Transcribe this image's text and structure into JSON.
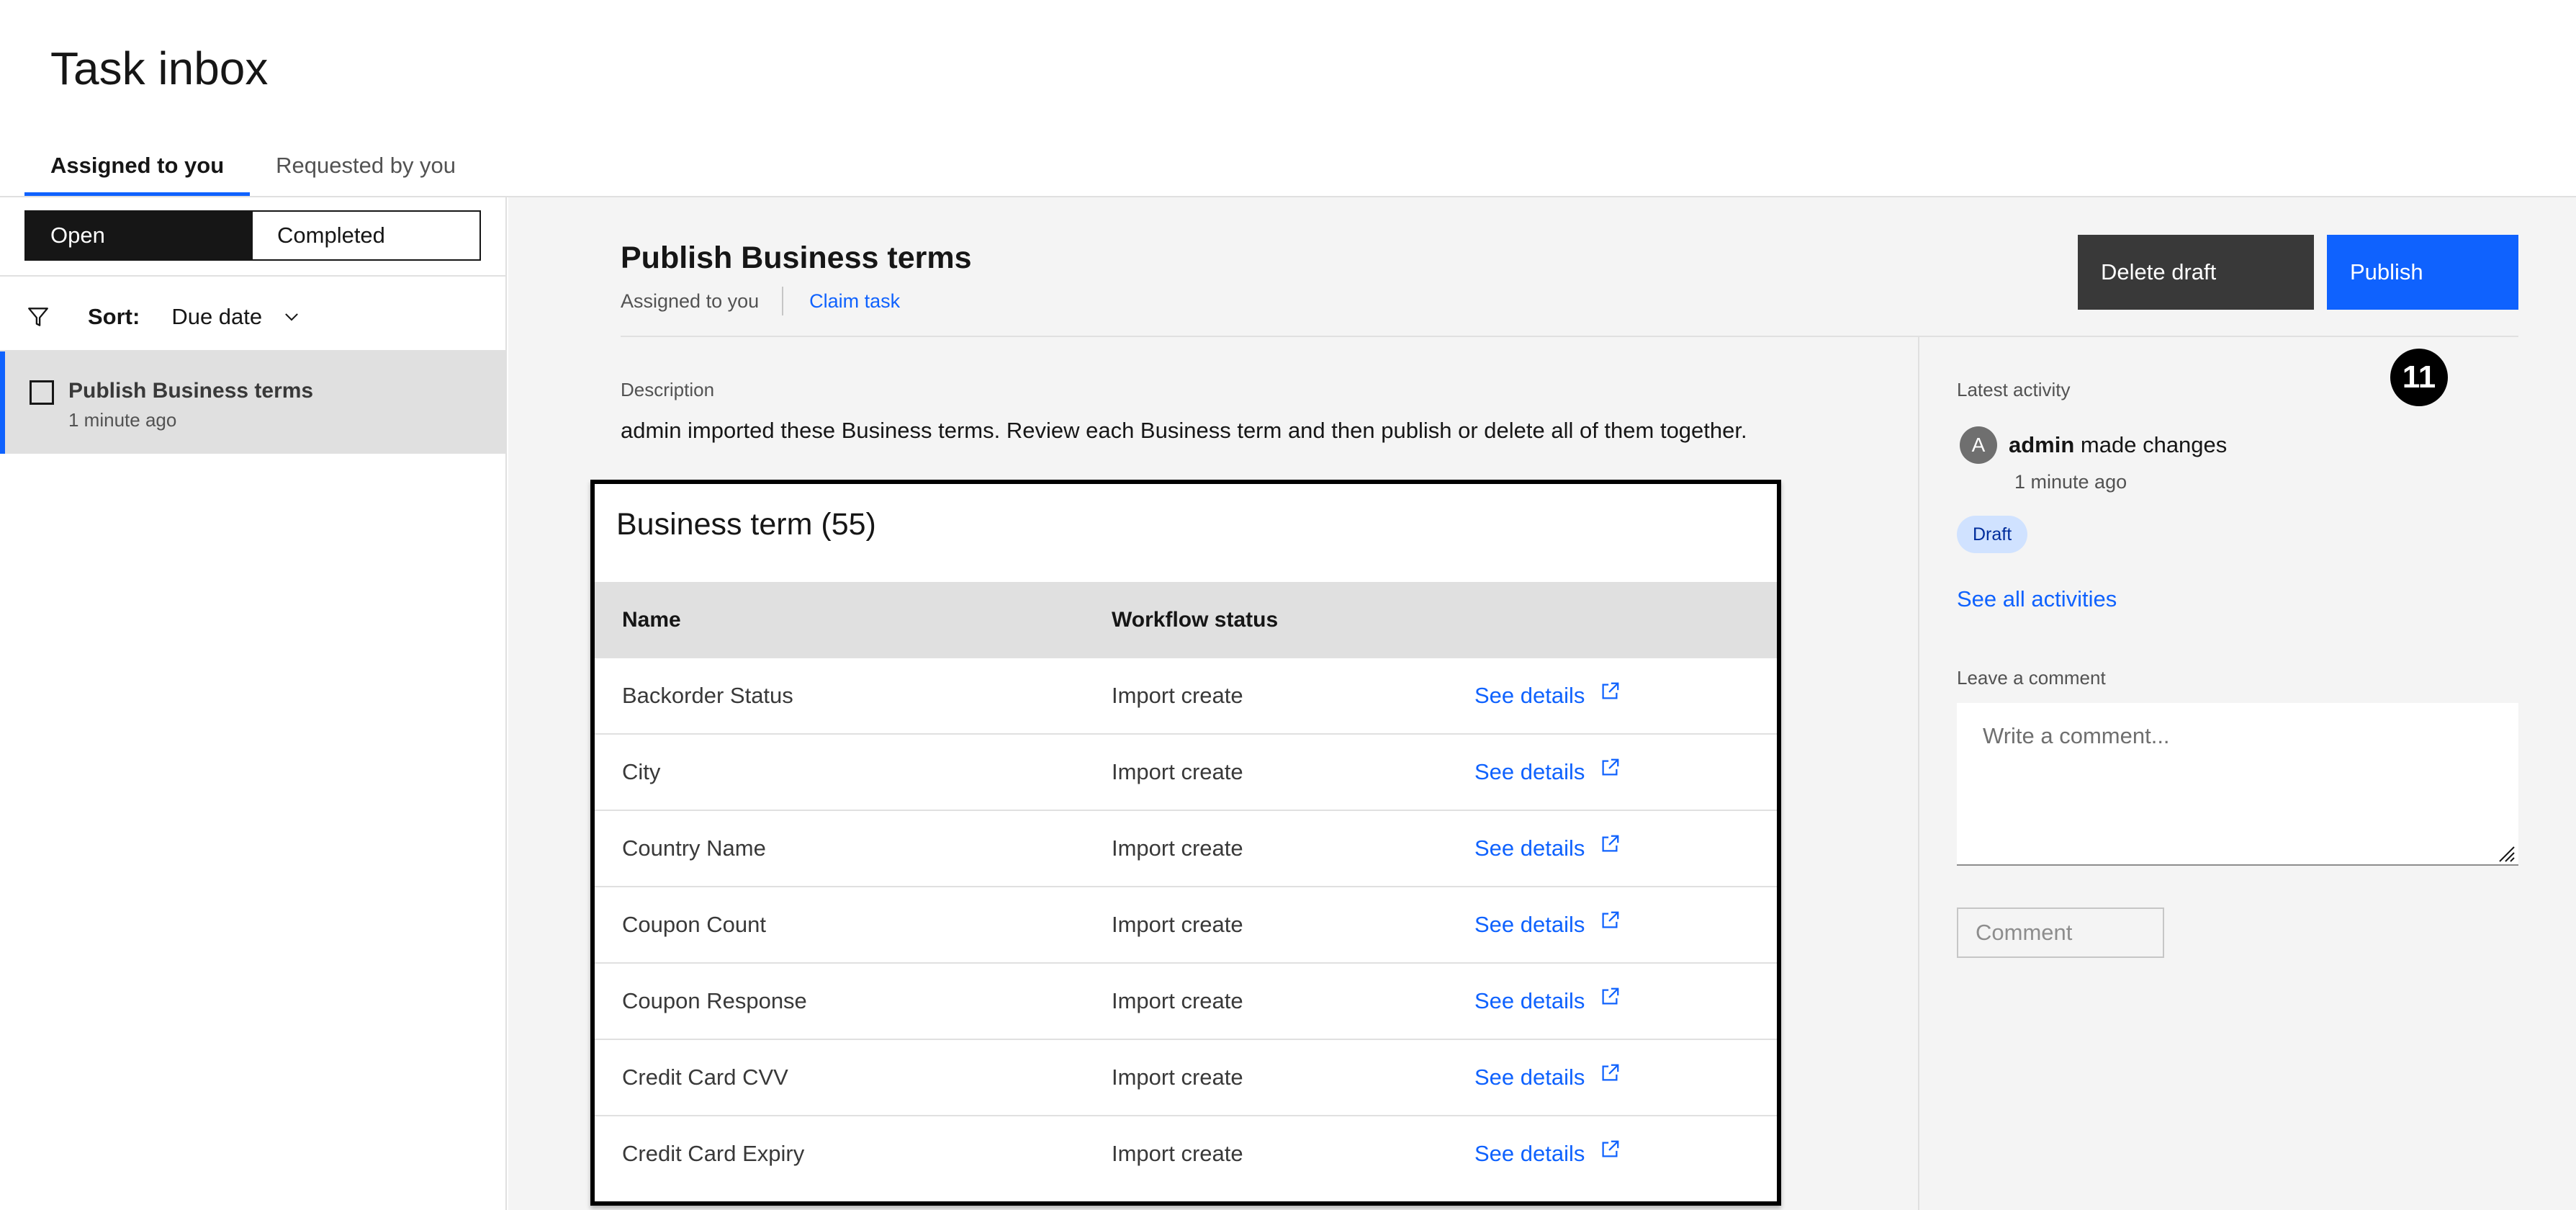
{
  "page": {
    "title": "Task inbox"
  },
  "tabs": [
    {
      "label": "Assigned to you",
      "active": true
    },
    {
      "label": "Requested by you",
      "active": false
    }
  ],
  "sidebar": {
    "segments": [
      {
        "label": "Open",
        "active": true
      },
      {
        "label": "Completed",
        "active": false
      }
    ],
    "filter_icon": "filter-icon",
    "sort_label": "Sort:",
    "sort_value": "Due date",
    "tasks": [
      {
        "title": "Publish Business terms",
        "time": "1 minute ago",
        "selected": true
      }
    ]
  },
  "main": {
    "title": "Publish Business terms",
    "assigned": "Assigned to you",
    "claim": "Claim task",
    "delete_label": "Delete draft",
    "publish_label": "Publish",
    "description_label": "Description",
    "description": "admin imported these Business terms. Review each Business term and then publish or delete all of them together.",
    "terms": {
      "heading": "Business term (55)",
      "col_name": "Name",
      "col_status": "Workflow status",
      "rows": [
        {
          "name": "Backorder Status",
          "status": "Import create",
          "link": "See details"
        },
        {
          "name": "City",
          "status": "Import create",
          "link": "See details"
        },
        {
          "name": "Country Name",
          "status": "Import create",
          "link": "See details"
        },
        {
          "name": "Coupon Count",
          "status": "Import create",
          "link": "See details"
        },
        {
          "name": "Coupon Response",
          "status": "Import create",
          "link": "See details"
        },
        {
          "name": "Credit Card CVV",
          "status": "Import create",
          "link": "See details"
        },
        {
          "name": "Credit Card Expiry",
          "status": "Import create",
          "link": "See details"
        }
      ]
    }
  },
  "activity": {
    "label": "Latest activity",
    "callout": "11",
    "avatar_initial": "A",
    "user": "admin",
    "action": "made changes",
    "time": "1 minute ago",
    "tag": "Draft",
    "see_all": "See all activities",
    "comment_label": "Leave a comment",
    "comment_placeholder": "Write a comment...",
    "comment_button": "Comment"
  },
  "colors": {
    "accent": "#0f62fe",
    "dark_button": "#393939",
    "tag_bg": "#d0e2ff"
  }
}
